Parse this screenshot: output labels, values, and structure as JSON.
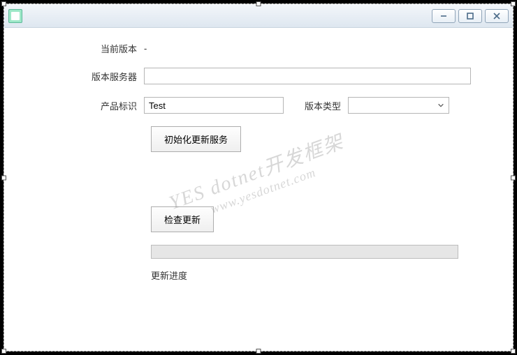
{
  "window": {
    "title": ""
  },
  "form": {
    "current_version_label": "当前版本",
    "current_version_value": "-",
    "server_label": "版本服务器",
    "server_value": "",
    "product_id_label": "产品标识",
    "product_id_value": "Test",
    "version_type_label": "版本类型",
    "version_type_value": "",
    "init_button": "初始化更新服务",
    "check_button": "检查更新",
    "progress_label": "更新进度",
    "progress_value": 0
  },
  "watermark": {
    "line1": "YES dotnet开发框架",
    "line2": "www.yesdotnet.com"
  }
}
